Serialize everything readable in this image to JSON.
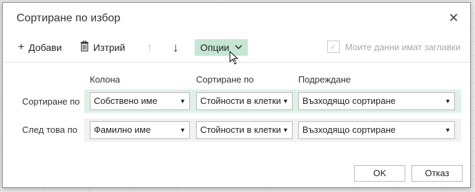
{
  "dialog": {
    "title": "Сортиране по избор",
    "close_symbol": "✕"
  },
  "toolbar": {
    "add_label": "Добави",
    "delete_label": "Изтрий",
    "options_label": "Опции",
    "headers_label": "Моите данни имат заглавки",
    "headers_checked": true,
    "headers_enabled": false
  },
  "columns": {
    "column": "Колона",
    "sort_on": "Сортиране по",
    "order": "Подреждане"
  },
  "rows": [
    {
      "label": "Сортиране по",
      "column": "Собствено име",
      "sort_on": "Стойности в клетки",
      "order": "Възходящо сортиране",
      "selected": true
    },
    {
      "label": "След това по",
      "column": "Фамилно име",
      "sort_on": "Стойности в клетки",
      "order": "Възходящо сортиране",
      "selected": false
    }
  ],
  "buttons": {
    "ok": "OK",
    "cancel": "Отказ"
  },
  "colors": {
    "selected_row": "#dff1e7",
    "options_highlight": "#c6e6d4"
  },
  "icons": {
    "add": "plus-icon",
    "delete": "trash-icon",
    "up": "arrow-up-icon",
    "down": "arrow-down-icon",
    "options": "chevron-down-icon",
    "close": "close-icon"
  }
}
